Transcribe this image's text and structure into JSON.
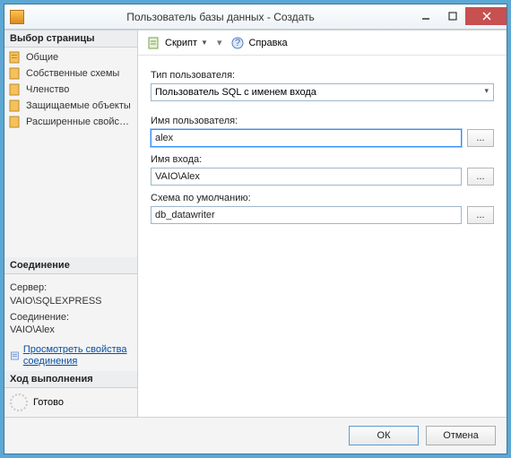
{
  "window": {
    "title": "Пользователь базы данных - Создать"
  },
  "sidebar": {
    "page_select_header": "Выбор страницы",
    "pages": [
      {
        "label": "Общие"
      },
      {
        "label": "Собственные схемы"
      },
      {
        "label": "Членство"
      },
      {
        "label": "Защищаемые объекты"
      },
      {
        "label": "Расширенные свойства"
      }
    ],
    "connection_header": "Соединение",
    "server_label": "Сервер:",
    "server_value": "VAIO\\SQLEXPRESS",
    "connection_label": "Соединение:",
    "connection_value": "VAIO\\Alex",
    "view_props_link": "Просмотреть свойства соединения",
    "progress_header": "Ход выполнения",
    "progress_status": "Готово"
  },
  "toolbar": {
    "script_label": "Скрипт",
    "help_label": "Справка"
  },
  "form": {
    "user_type_label": "Тип пользователя:",
    "user_type_value": "Пользователь SQL с именем входа",
    "user_name_label": "Имя пользователя:",
    "user_name_value": "alex",
    "login_label": "Имя входа:",
    "login_value": "VAIO\\Alex",
    "default_schema_label": "Схема по умолчанию:",
    "default_schema_value": "db_datawriter",
    "browse_label": "..."
  },
  "footer": {
    "ok": "ОК",
    "cancel": "Отмена"
  }
}
